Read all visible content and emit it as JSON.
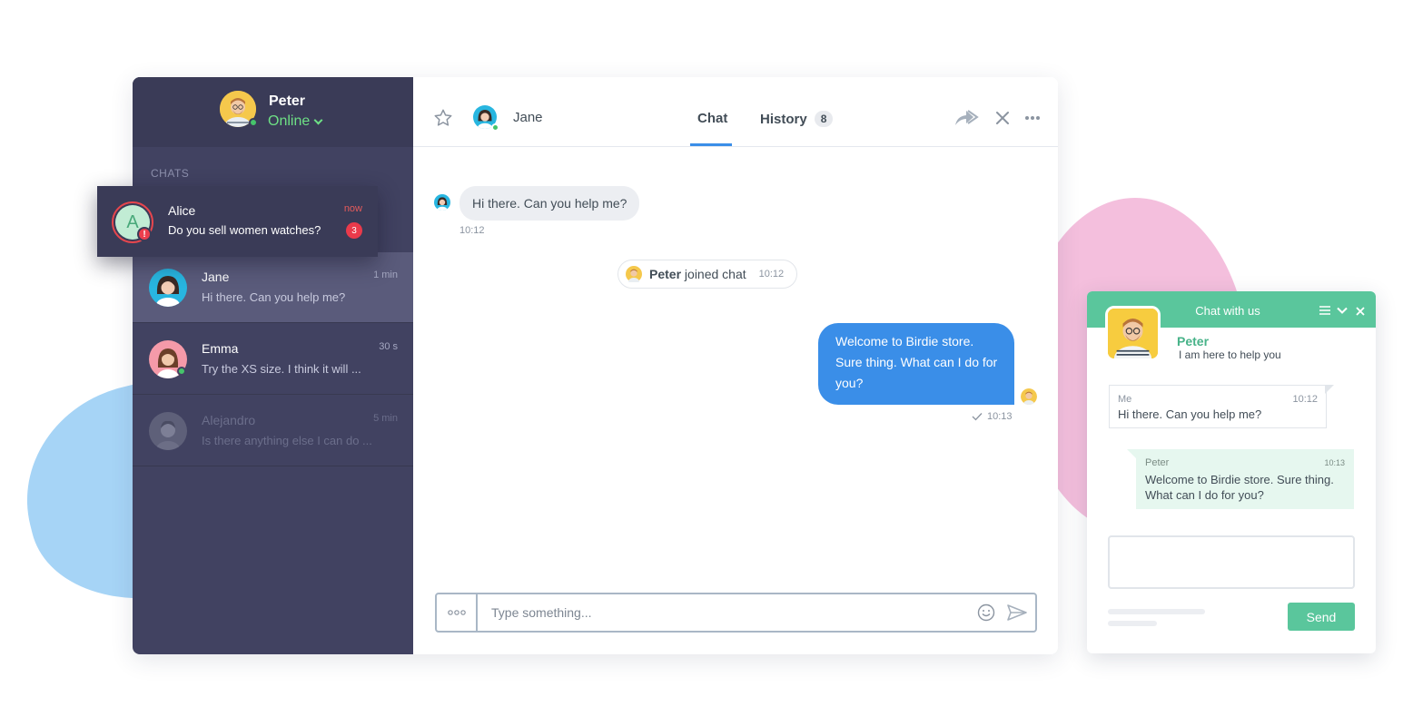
{
  "agent": {
    "name": "Peter",
    "status": "Online"
  },
  "sidebar": {
    "section_label": "CHATS",
    "chats": [
      {
        "name": "Alice",
        "preview": "Do you sell women watches?",
        "time": "now",
        "unread": "3",
        "initial": "A",
        "alert": "!"
      },
      {
        "name": "Jane",
        "preview": "Hi there. Can you help me?",
        "time": "1 min"
      },
      {
        "name": "Emma",
        "preview": "Try the XS size. I think it will ...",
        "time": "30 s"
      },
      {
        "name": "Alejandro",
        "preview": "Is there anything else I can do ...",
        "time": "5 min"
      }
    ]
  },
  "conversation": {
    "contact_name": "Jane",
    "tabs": [
      {
        "label": "Chat"
      },
      {
        "label": "History",
        "count": "8"
      }
    ],
    "messages": [
      {
        "text": "Hi there. Can you help me?",
        "time": "10:12"
      },
      {
        "text": "Welcome to Birdie store. Sure thing. What can I do for you?",
        "time": "10:13"
      }
    ],
    "system_event": {
      "actor": "Peter",
      "text": "joined chat",
      "time": "10:12"
    },
    "composer": {
      "placeholder": "Type something..."
    }
  },
  "widget": {
    "title": "Chat with us",
    "agent_name": "Peter",
    "agent_subtitle": "I am here to help you",
    "messages": [
      {
        "sender": "Me",
        "time": "10:12",
        "text": "Hi there. Can you help me?"
      },
      {
        "sender": "Peter",
        "time": "10:13",
        "text_lines": [
          "Welcome to Birdie store. Sure thing.",
          "What can I do for you?"
        ]
      }
    ],
    "send_label": "Send"
  },
  "colors": {
    "sidebar_bg": "#414261",
    "accent_blue": "#3a8ee8",
    "online_green": "#6ee085",
    "widget_green": "#5ac69c",
    "alert_red": "#ea3a4b"
  }
}
